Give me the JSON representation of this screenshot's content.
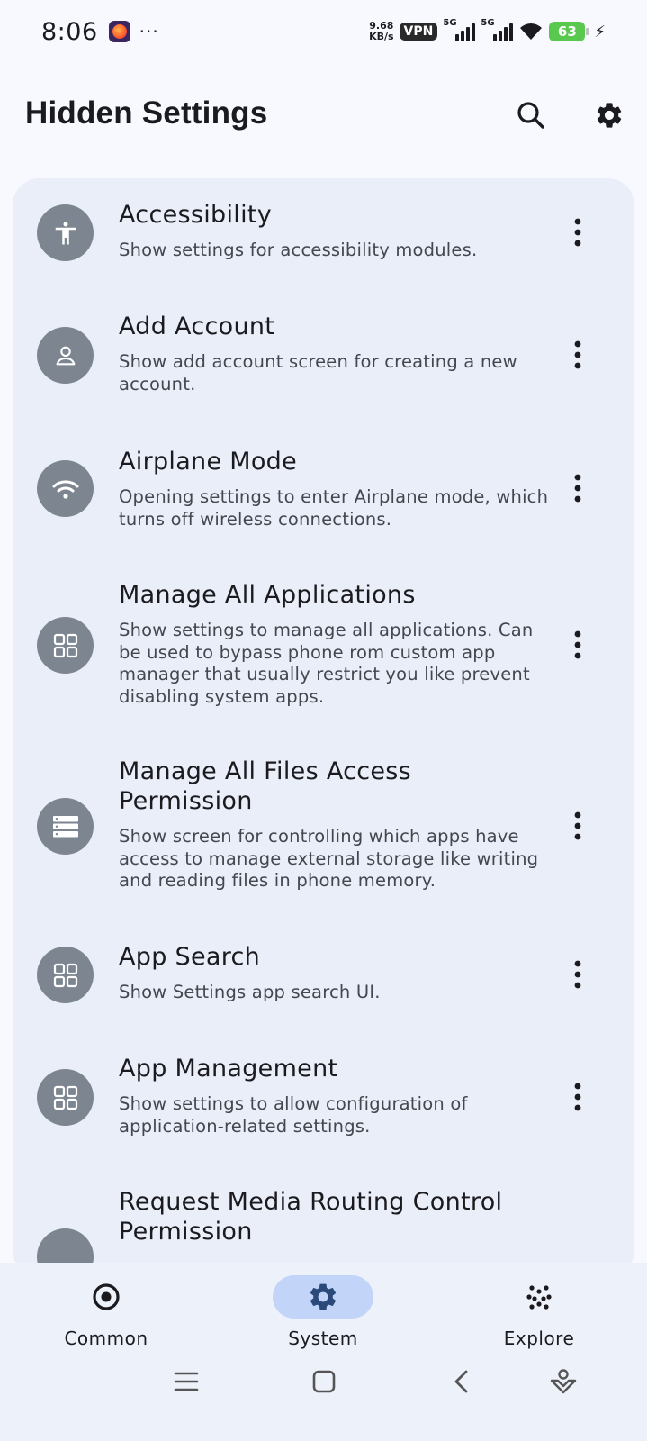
{
  "status_bar": {
    "time": "8:06",
    "dots": "···",
    "net_speed_value": "9.68",
    "net_speed_unit": "KB/s",
    "vpn": "VPN",
    "sim1": "5G",
    "sim2": "5G",
    "battery": "63"
  },
  "app_bar": {
    "title": "Hidden Settings",
    "search_icon": "search-icon",
    "settings_icon": "gear-icon"
  },
  "items": [
    {
      "title": "Accessibility",
      "desc": "Show settings for accessibility modules.",
      "icon": "accessibility-icon"
    },
    {
      "title": "Add Account",
      "desc": "Show add account screen for creating a new account.",
      "icon": "person-icon"
    },
    {
      "title": "Airplane Mode",
      "desc": "Opening settings to enter Airplane mode, which turns off wireless connections.",
      "icon": "wifi-icon"
    },
    {
      "title": "Manage All Applications",
      "desc": "Show settings to manage all applications. Can be used to bypass phone rom custom app manager that usually restrict you like prevent disabling system apps.",
      "icon": "apps-grid-icon"
    },
    {
      "title": "Manage All Files Access Permission",
      "desc": "Show screen for controlling which apps have access to manage external storage like writing and reading files in phone memory.",
      "icon": "storage-icon"
    },
    {
      "title": "App Search",
      "desc": "Show Settings app search UI.",
      "icon": "apps-grid-icon"
    },
    {
      "title": "App Management",
      "desc": "Show settings to allow configuration of application-related settings.",
      "icon": "apps-grid-icon"
    },
    {
      "title": "Request Media Routing Control Permission",
      "desc": "",
      "icon": "apps-grid-icon"
    }
  ],
  "bottom_nav": {
    "tabs": [
      {
        "label": "Common",
        "icon": "radio-target-icon",
        "active": false
      },
      {
        "label": "System",
        "icon": "gear-icon",
        "active": true
      },
      {
        "label": "Explore",
        "icon": "dots-cluster-icon",
        "active": false
      }
    ],
    "accent": "#c2d5f8"
  }
}
